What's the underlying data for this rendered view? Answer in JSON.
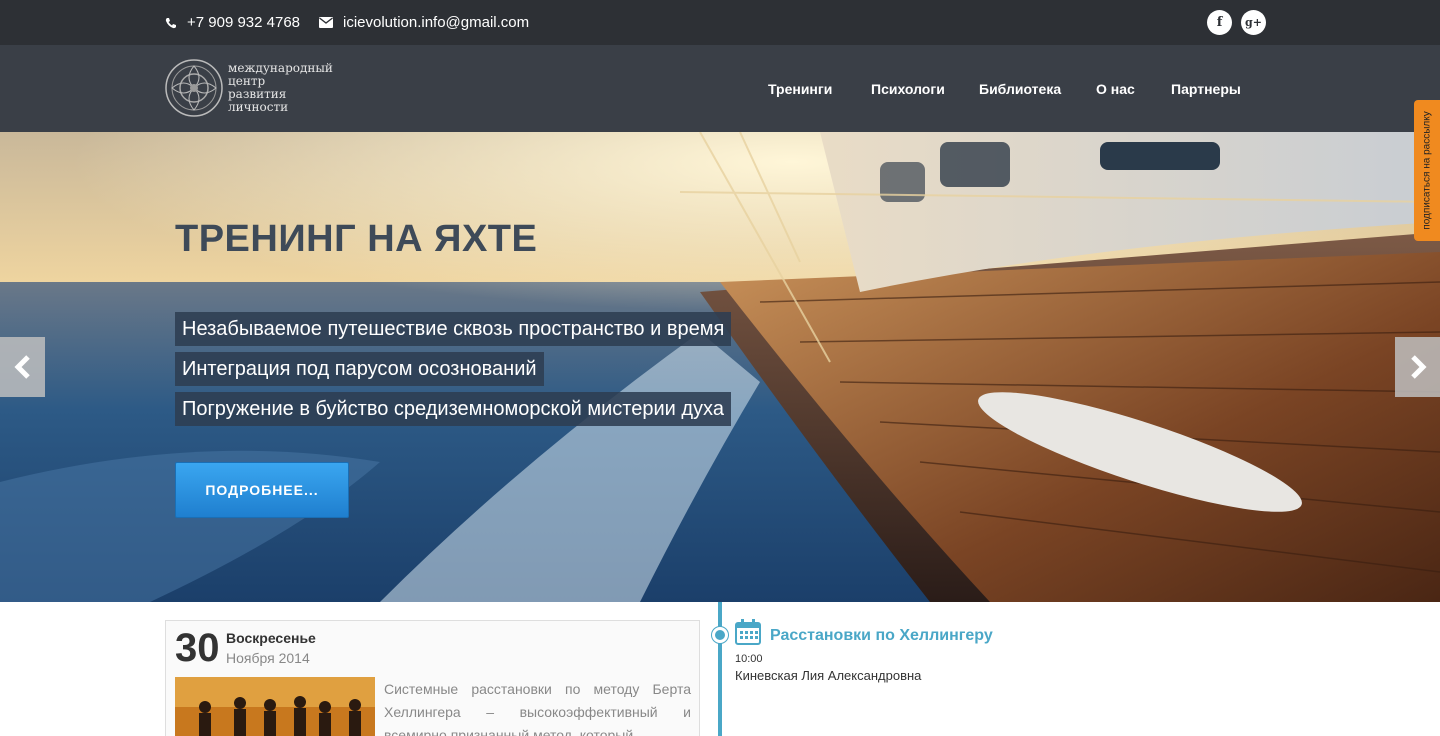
{
  "topbar": {
    "phone": "+7 909 932 4768",
    "email": "icievolution.info@gmail.com",
    "social": [
      {
        "icon": "facebook-icon",
        "label": "f"
      },
      {
        "icon": "google-plus-icon",
        "label": "g+"
      }
    ]
  },
  "logo": {
    "line1": "международный",
    "line2": "центр",
    "line3": "развития",
    "line4": "личности"
  },
  "nav": {
    "items": [
      {
        "label": "Тренинги"
      },
      {
        "label": "Психологи"
      },
      {
        "label": "Библиотека"
      },
      {
        "label": "О нас"
      },
      {
        "label": "Партнеры"
      }
    ]
  },
  "subscribe_tab": "подписаться на рассылку",
  "hero": {
    "title": "ТРЕНИНГ НА ЯХТЕ",
    "lines": [
      "Незабываемое путешествие сквозь пространство и время",
      "Интеграция под парусом осознований",
      "Погружение в буйство средиземноморской мистерии духа"
    ],
    "button": "ПОДРОБНЕЕ..."
  },
  "event": {
    "day": "30",
    "weekday": "Воскресенье",
    "month_year": "Ноября 2014",
    "description": "Системные расстановки по методу Берта Хеллингера – высокоэффективный и всемирно признанный метод, который",
    "title": "Расстановки по Хеллингеру",
    "time": "10:00",
    "person": "Киневская Лия Александровна"
  },
  "colors": {
    "topbar_bg": "#2d3035",
    "header_bg": "#3a3f47",
    "accent": "#4aa7c7",
    "button": "#2a8fe0",
    "subscribe": "#f08a1f"
  }
}
